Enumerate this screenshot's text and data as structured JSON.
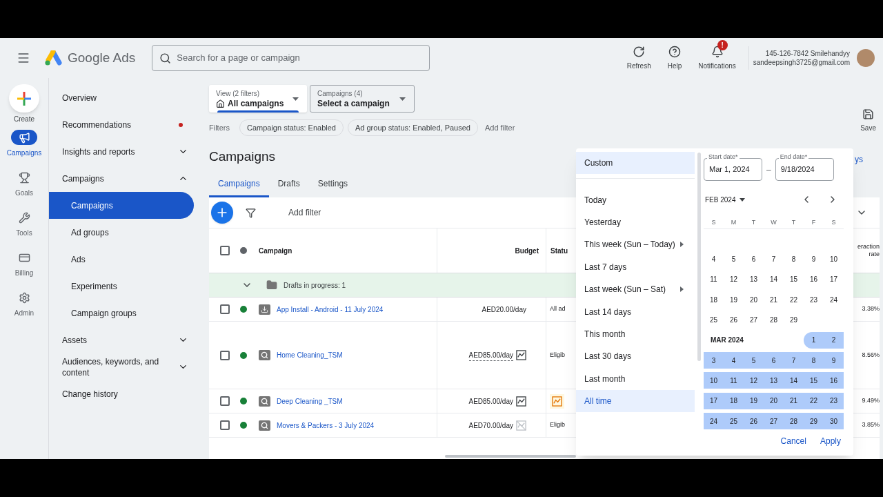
{
  "header": {
    "product": "Google Ads",
    "search": {
      "placeholder": "Search for a page or campaign"
    },
    "actions": [
      {
        "kind": "refresh",
        "label": "Refresh"
      },
      {
        "kind": "help",
        "label": "Help"
      },
      {
        "kind": "notifications",
        "label": "Notifications",
        "badge": "!"
      }
    ],
    "account": {
      "name": "145-126-7842 Smilehandyy",
      "email": "sandeepsingh3725@gmail.com"
    }
  },
  "rail": [
    {
      "kind": "create",
      "label": "Create",
      "selected": false
    },
    {
      "kind": "campaigns",
      "label": "Campaigns",
      "selected": true
    },
    {
      "kind": "goals",
      "label": "Goals",
      "selected": false
    },
    {
      "kind": "tools",
      "label": "Tools",
      "selected": false
    },
    {
      "kind": "billing",
      "label": "Billing",
      "selected": false
    },
    {
      "kind": "admin",
      "label": "Admin",
      "selected": false
    }
  ],
  "nav": [
    {
      "label": "Overview",
      "selected": false,
      "alert": false
    },
    {
      "label": "Recommendations",
      "selected": false,
      "alert": true
    },
    {
      "label": "Insights and reports",
      "selected": false,
      "alert": false,
      "expanded": false
    },
    {
      "label": "Campaigns",
      "selected": false,
      "alert": false,
      "expanded": true,
      "children": [
        {
          "label": "Campaigns",
          "selected": true
        },
        {
          "label": "Ad groups",
          "selected": false
        },
        {
          "label": "Ads",
          "selected": false
        },
        {
          "label": "Experiments",
          "selected": false
        },
        {
          "label": "Campaign groups",
          "selected": false
        }
      ]
    },
    {
      "label": "Assets",
      "selected": false,
      "alert": false,
      "expanded": false
    },
    {
      "label": "Audiences, keywords, and content",
      "selected": false,
      "alert": false,
      "expanded": false
    },
    {
      "label": "Change history",
      "selected": false,
      "alert": false
    }
  ],
  "selectors": [
    {
      "kind": "view",
      "caption": "View (2 filters)",
      "value": "All campaigns"
    },
    {
      "kind": "campaign",
      "caption": "Campaigns (4)",
      "value": "Select a campaign"
    }
  ],
  "filters": {
    "label": "Filters",
    "chips": [
      "Campaign status: Enabled",
      "Ad group status: Enabled, Paused"
    ],
    "add": "Add filter"
  },
  "save": "Save",
  "page_title": "Campaigns",
  "tabs": [
    {
      "label": "Campaigns",
      "selected": true
    },
    {
      "label": "Drafts",
      "selected": false
    },
    {
      "label": "Settings",
      "selected": false
    }
  ],
  "date_link": "ys",
  "table": {
    "add_filter": "Add filter",
    "select_all": {
      "checked": false
    },
    "columns": {
      "campaign": "Campaign",
      "budget": "Budget",
      "status": "Statu",
      "column_right": "eraction rate"
    },
    "drafts": "Drafts in progress: 1",
    "rows": [
      {
        "kind": "app",
        "campaign": "App Install - Android - 11 July 2024",
        "budget": "AED20.00/day",
        "chart": false,
        "dashed": false,
        "status": "All ad",
        "warning": false,
        "rate": "3.38%",
        "color": "#188038",
        "checked": false,
        "tall": false
      },
      {
        "kind": "search",
        "campaign": "Home Cleaning_TSM",
        "budget": "AED85.00/day",
        "chart": true,
        "chart_disabled": false,
        "dashed": true,
        "status": "Eligib",
        "warning": false,
        "rate": "8.56%",
        "color": "#188038",
        "checked": false,
        "tall": true
      },
      {
        "kind": "search",
        "campaign": "Deep Cleaning _TSM",
        "budget": "AED85.00/day",
        "chart": true,
        "chart_disabled": false,
        "dashed": false,
        "warning": true,
        "rate": "9.49%",
        "color": "#188038",
        "checked": false,
        "tall": false
      },
      {
        "kind": "search",
        "campaign": "Movers & Packers - 3 July 2024",
        "budget": "AED70.00/day",
        "chart": true,
        "chart_disabled": true,
        "dashed": false,
        "status": "Eligib",
        "warning": false,
        "rate": "3.85%",
        "color": "#188038",
        "checked": false,
        "tall": false
      }
    ]
  },
  "date_picker": {
    "presets": [
      {
        "label": "Custom",
        "kind": "custom",
        "selected": true,
        "submenu": false
      },
      {
        "label": "Today",
        "kind": "preset",
        "selected": false,
        "submenu": false
      },
      {
        "label": "Yesterday",
        "kind": "preset",
        "selected": false,
        "submenu": false
      },
      {
        "label": "This week (Sun – Today)",
        "kind": "preset",
        "selected": false,
        "submenu": true
      },
      {
        "label": "Last 7 days",
        "kind": "preset",
        "selected": false,
        "submenu": false
      },
      {
        "label": "Last week (Sun – Sat)",
        "kind": "preset",
        "selected": false,
        "submenu": true
      },
      {
        "label": "Last 14 days",
        "kind": "preset",
        "selected": false,
        "submenu": false
      },
      {
        "label": "This month",
        "kind": "preset",
        "selected": false,
        "submenu": false
      },
      {
        "label": "Last 30 days",
        "kind": "preset",
        "selected": false,
        "submenu": false
      },
      {
        "label": "Last month",
        "kind": "preset",
        "selected": false,
        "submenu": false
      },
      {
        "label": "All time",
        "kind": "preset",
        "selected": true,
        "submenu": false
      }
    ],
    "start": {
      "label": "Start date*",
      "value": "Mar 1, 2024"
    },
    "separator": "–",
    "end": {
      "label": "End date*",
      "value": "9/18/2024"
    },
    "month_picker": "FEB 2024",
    "weekdays": [
      "S",
      "M",
      "T",
      "W",
      "T",
      "F",
      "S"
    ],
    "months": [
      {
        "weeks": [
          {
            "days": [
              {
                "day": "4",
                "in_range": false
              },
              {
                "day": "5",
                "in_range": false
              },
              {
                "day": "6",
                "in_range": false
              },
              {
                "day": "7",
                "in_range": false
              },
              {
                "day": "8",
                "in_range": false
              },
              {
                "day": "9",
                "in_range": false
              },
              {
                "day": "10",
                "in_range": false
              }
            ]
          },
          {
            "days": [
              {
                "day": "11",
                "in_range": false
              },
              {
                "day": "12",
                "in_range": false
              },
              {
                "day": "13",
                "in_range": false
              },
              {
                "day": "14",
                "in_range": false
              },
              {
                "day": "15",
                "in_range": false
              },
              {
                "day": "16",
                "in_range": false
              },
              {
                "day": "17",
                "in_range": false
              }
            ]
          },
          {
            "days": [
              {
                "day": "18",
                "in_range": false
              },
              {
                "day": "19",
                "in_range": false
              },
              {
                "day": "20",
                "in_range": false
              },
              {
                "day": "21",
                "in_range": false
              },
              {
                "day": "22",
                "in_range": false
              },
              {
                "day": "23",
                "in_range": false
              },
              {
                "day": "24",
                "in_range": false
              }
            ]
          },
          {
            "days": [
              {
                "day": "25",
                "in_range": false
              },
              {
                "day": "26",
                "in_range": false
              },
              {
                "day": "27",
                "in_range": false
              },
              {
                "day": "28",
                "in_range": false
              },
              {
                "day": "29",
                "in_range": false
              }
            ]
          }
        ]
      },
      {
        "label": "MAR 2024",
        "weeks": [
          {
            "days": [
              {
                "day": "1",
                "in_range": true
              },
              {
                "day": "2",
                "in_range": true
              }
            ]
          },
          {
            "days": [
              {
                "day": "3",
                "in_range": true
              },
              {
                "day": "4",
                "in_range": true
              },
              {
                "day": "5",
                "in_range": true
              },
              {
                "day": "6",
                "in_range": true
              },
              {
                "day": "7",
                "in_range": true
              },
              {
                "day": "8",
                "in_range": true
              },
              {
                "day": "9",
                "in_range": true
              }
            ]
          },
          {
            "days": [
              {
                "day": "10",
                "in_range": true
              },
              {
                "day": "11",
                "in_range": true
              },
              {
                "day": "12",
                "in_range": true
              },
              {
                "day": "13",
                "in_range": true
              },
              {
                "day": "14",
                "in_range": true
              },
              {
                "day": "15",
                "in_range": true
              },
              {
                "day": "16",
                "in_range": true
              }
            ]
          },
          {
            "days": [
              {
                "day": "17",
                "in_range": true
              },
              {
                "day": "18",
                "in_range": true
              },
              {
                "day": "19",
                "in_range": true
              },
              {
                "day": "20",
                "in_range": true
              },
              {
                "day": "21",
                "in_range": true
              },
              {
                "day": "22",
                "in_range": true
              },
              {
                "day": "23",
                "in_range": true
              }
            ]
          },
          {
            "days": [
              {
                "day": "24",
                "in_range": true
              },
              {
                "day": "25",
                "in_range": true
              },
              {
                "day": "26",
                "in_range": true
              },
              {
                "day": "27",
                "in_range": true
              },
              {
                "day": "28",
                "in_range": true
              },
              {
                "day": "29",
                "in_range": true
              },
              {
                "day": "30",
                "in_range": true
              }
            ]
          }
        ]
      }
    ],
    "cancel": "Cancel",
    "apply": "Apply"
  }
}
